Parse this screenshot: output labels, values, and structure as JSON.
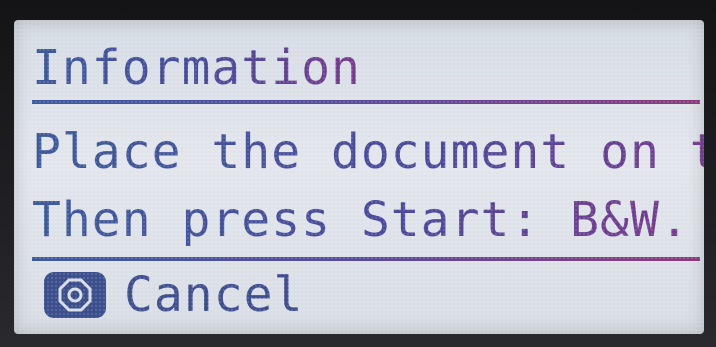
{
  "screen": {
    "title": "Information",
    "message_line1": "Place the document on th",
    "message_line2": "Then press Start: B&W.",
    "cancel_label": "Cancel"
  },
  "icons": {
    "cancel": "stop-icon"
  },
  "colors": {
    "lcd_background": "#dfe3e9",
    "text_blue": "#3e5a9a",
    "text_purple": "#7a3a8c",
    "icon_fill": "#3a4f8c"
  }
}
